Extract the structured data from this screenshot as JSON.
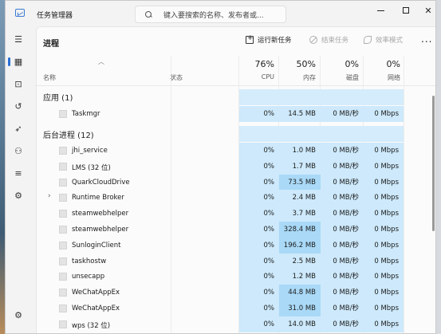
{
  "window": {
    "title": "任务管理器",
    "search_placeholder": "键入要搜索的名称、发布者或..."
  },
  "toolbar": {
    "page_title": "进程",
    "run_new_task": "运行新任务",
    "end_task": "结束任务",
    "efficiency_mode": "效率模式",
    "more": "..."
  },
  "header": {
    "name": "名称",
    "status": "状态",
    "cpu_pct": "76%",
    "cpu_label": "CPU",
    "mem_pct": "50%",
    "mem_label": "内存",
    "disk_pct": "0%",
    "disk_label": "磁盘",
    "net_pct": "0%",
    "net_label": "网络"
  },
  "groups": {
    "apps": "应用 (1)",
    "background": "后台进程 (12)"
  },
  "apps": [
    {
      "name": "Taskmgr",
      "cpu": "0%",
      "mem": "14.5 MB",
      "disk": "0 MB/秒",
      "net": "0 Mbps",
      "expandable": false
    }
  ],
  "background": [
    {
      "name": "jhi_service",
      "cpu": "0%",
      "mem": "1.0 MB",
      "disk": "0 MB/秒",
      "net": "0 Mbps",
      "expandable": false,
      "mem_heat": "low"
    },
    {
      "name": "LMS (32 位)",
      "cpu": "0%",
      "mem": "1.7 MB",
      "disk": "0 MB/秒",
      "net": "0 Mbps",
      "expandable": false,
      "mem_heat": "low"
    },
    {
      "name": "QuarkCloudDrive",
      "cpu": "0%",
      "mem": "73.5 MB",
      "disk": "0 MB/秒",
      "net": "0 Mbps",
      "expandable": false,
      "mem_heat": "mid"
    },
    {
      "name": "Runtime Broker",
      "cpu": "0%",
      "mem": "2.4 MB",
      "disk": "0 MB/秒",
      "net": "0 Mbps",
      "expandable": true,
      "mem_heat": "low"
    },
    {
      "name": "steamwebhelper",
      "cpu": "0%",
      "mem": "3.7 MB",
      "disk": "0 MB/秒",
      "net": "0 Mbps",
      "expandable": false,
      "mem_heat": "low"
    },
    {
      "name": "steamwebhelper",
      "cpu": "0%",
      "mem": "328.4 MB",
      "disk": "0 MB/秒",
      "net": "0 Mbps",
      "expandable": false,
      "mem_heat": "mid"
    },
    {
      "name": "SunloginClient",
      "cpu": "0%",
      "mem": "196.2 MB",
      "disk": "0 MB/秒",
      "net": "0 Mbps",
      "expandable": false,
      "mem_heat": "mid"
    },
    {
      "name": "taskhostw",
      "cpu": "0%",
      "mem": "2.5 MB",
      "disk": "0 MB/秒",
      "net": "0 Mbps",
      "expandable": false,
      "mem_heat": "low"
    },
    {
      "name": "unsecapp",
      "cpu": "0%",
      "mem": "1.2 MB",
      "disk": "0 MB/秒",
      "net": "0 Mbps",
      "expandable": false,
      "mem_heat": "low"
    },
    {
      "name": "WeChatAppEx",
      "cpu": "0%",
      "mem": "44.8 MB",
      "disk": "0 MB/秒",
      "net": "0 Mbps",
      "expandable": false,
      "mem_heat": "mid"
    },
    {
      "name": "WeChatAppEx",
      "cpu": "0%",
      "mem": "31.0 MB",
      "disk": "0 MB/秒",
      "net": "0 Mbps",
      "expandable": false,
      "mem_heat": "mid"
    },
    {
      "name": "wps (32 位)",
      "cpu": "0%",
      "mem": "14.0 MB",
      "disk": "0 MB/秒",
      "net": "0 Mbps",
      "expandable": false,
      "mem_heat": "low"
    }
  ],
  "colors": {
    "accent": "#2a6fd6",
    "heat_low": "#cde9fb",
    "heat_mid": "#a9d9f7"
  },
  "icons": {
    "nav": [
      "hamburger-icon",
      "processes-icon",
      "performance-icon",
      "app-history-icon",
      "startup-apps-icon",
      "users-icon",
      "details-icon",
      "services-icon",
      "settings-icon"
    ]
  }
}
